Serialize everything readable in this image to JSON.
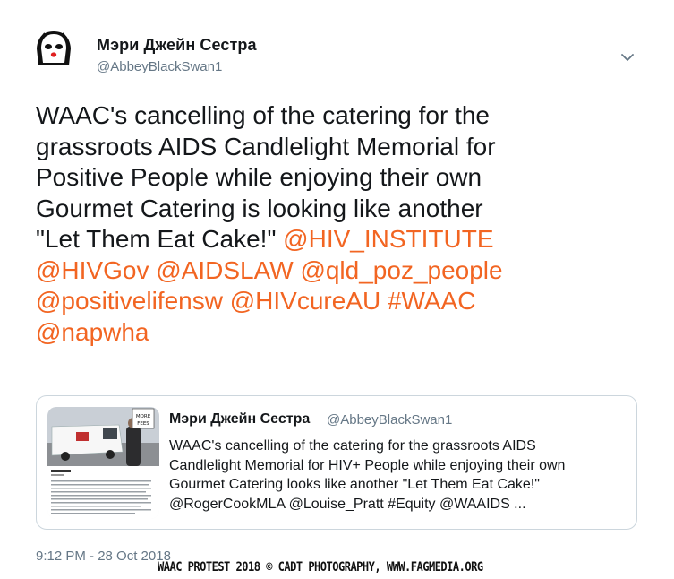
{
  "author": {
    "name": "Мэри Джейн Сестра",
    "handle": "@AbbeyBlackSwan1",
    "avatar_icon": "nun-cartoon-avatar-icon"
  },
  "menu_icon": "chevron-down-icon",
  "tweet": {
    "lines": [
      {
        "parts": [
          {
            "text": "WAAC's cancelling of the catering for the",
            "link": false
          }
        ]
      },
      {
        "parts": [
          {
            "text": "grassroots AIDS Candlelight  Memorial for",
            "link": false
          }
        ]
      },
      {
        "parts": [
          {
            "text": "Positive People while enjoying  their own",
            "link": false
          }
        ]
      },
      {
        "parts": [
          {
            "text": "Gourmet Catering  is looking like another",
            "link": false
          }
        ]
      },
      {
        "parts": [
          {
            "text": "\"Let Them Eat Cake!\" ",
            "link": false
          },
          {
            "text": "@HIV_INSTITUTE",
            "link": true
          }
        ]
      },
      {
        "parts": [
          {
            "text": "@HIVGov",
            "link": true
          },
          {
            "text": " ",
            "link": false
          },
          {
            "text": "@AIDSLAW",
            "link": true
          },
          {
            "text": " ",
            "link": false
          },
          {
            "text": "@qld_poz_people",
            "link": true
          }
        ]
      },
      {
        "parts": [
          {
            "text": "@positivelifensw",
            "link": true
          },
          {
            "text": " ",
            "link": false
          },
          {
            "text": "@HIVcureAU",
            "link": true
          },
          {
            "text": " ",
            "link": false
          },
          {
            "text": "#WAAC",
            "link": true
          }
        ]
      },
      {
        "parts": [
          {
            "text": "@napwha",
            "link": true
          }
        ]
      }
    ]
  },
  "quoted_tweet": {
    "name": "Мэри Джейн Сестра",
    "handle": "@AbbeyBlackSwan1",
    "thumbnail_sign_text": "MORE FEES",
    "lines": [
      "WAAC's cancelling of the catering for the grassroots AIDS",
      "Candlelight  Memorial for HIV+ People while enjoying their own",
      "Gourmet Catering looks like another \"Let Them Eat Cake!\"",
      "@RogerCookMLA @Louise_Pratt #Equity @WAAIDS ..."
    ]
  },
  "timestamp": "9:12 PM - 28 Oct 2018",
  "watermark": "WAAC PROTEST 2018 © CADT PHOTOGRAPHY, WWW.FAGMEDIA.ORG",
  "colors": {
    "link": "#f26522",
    "secondary_text": "#657786",
    "border": "#ccd6dd",
    "primary_text": "#14171a"
  }
}
